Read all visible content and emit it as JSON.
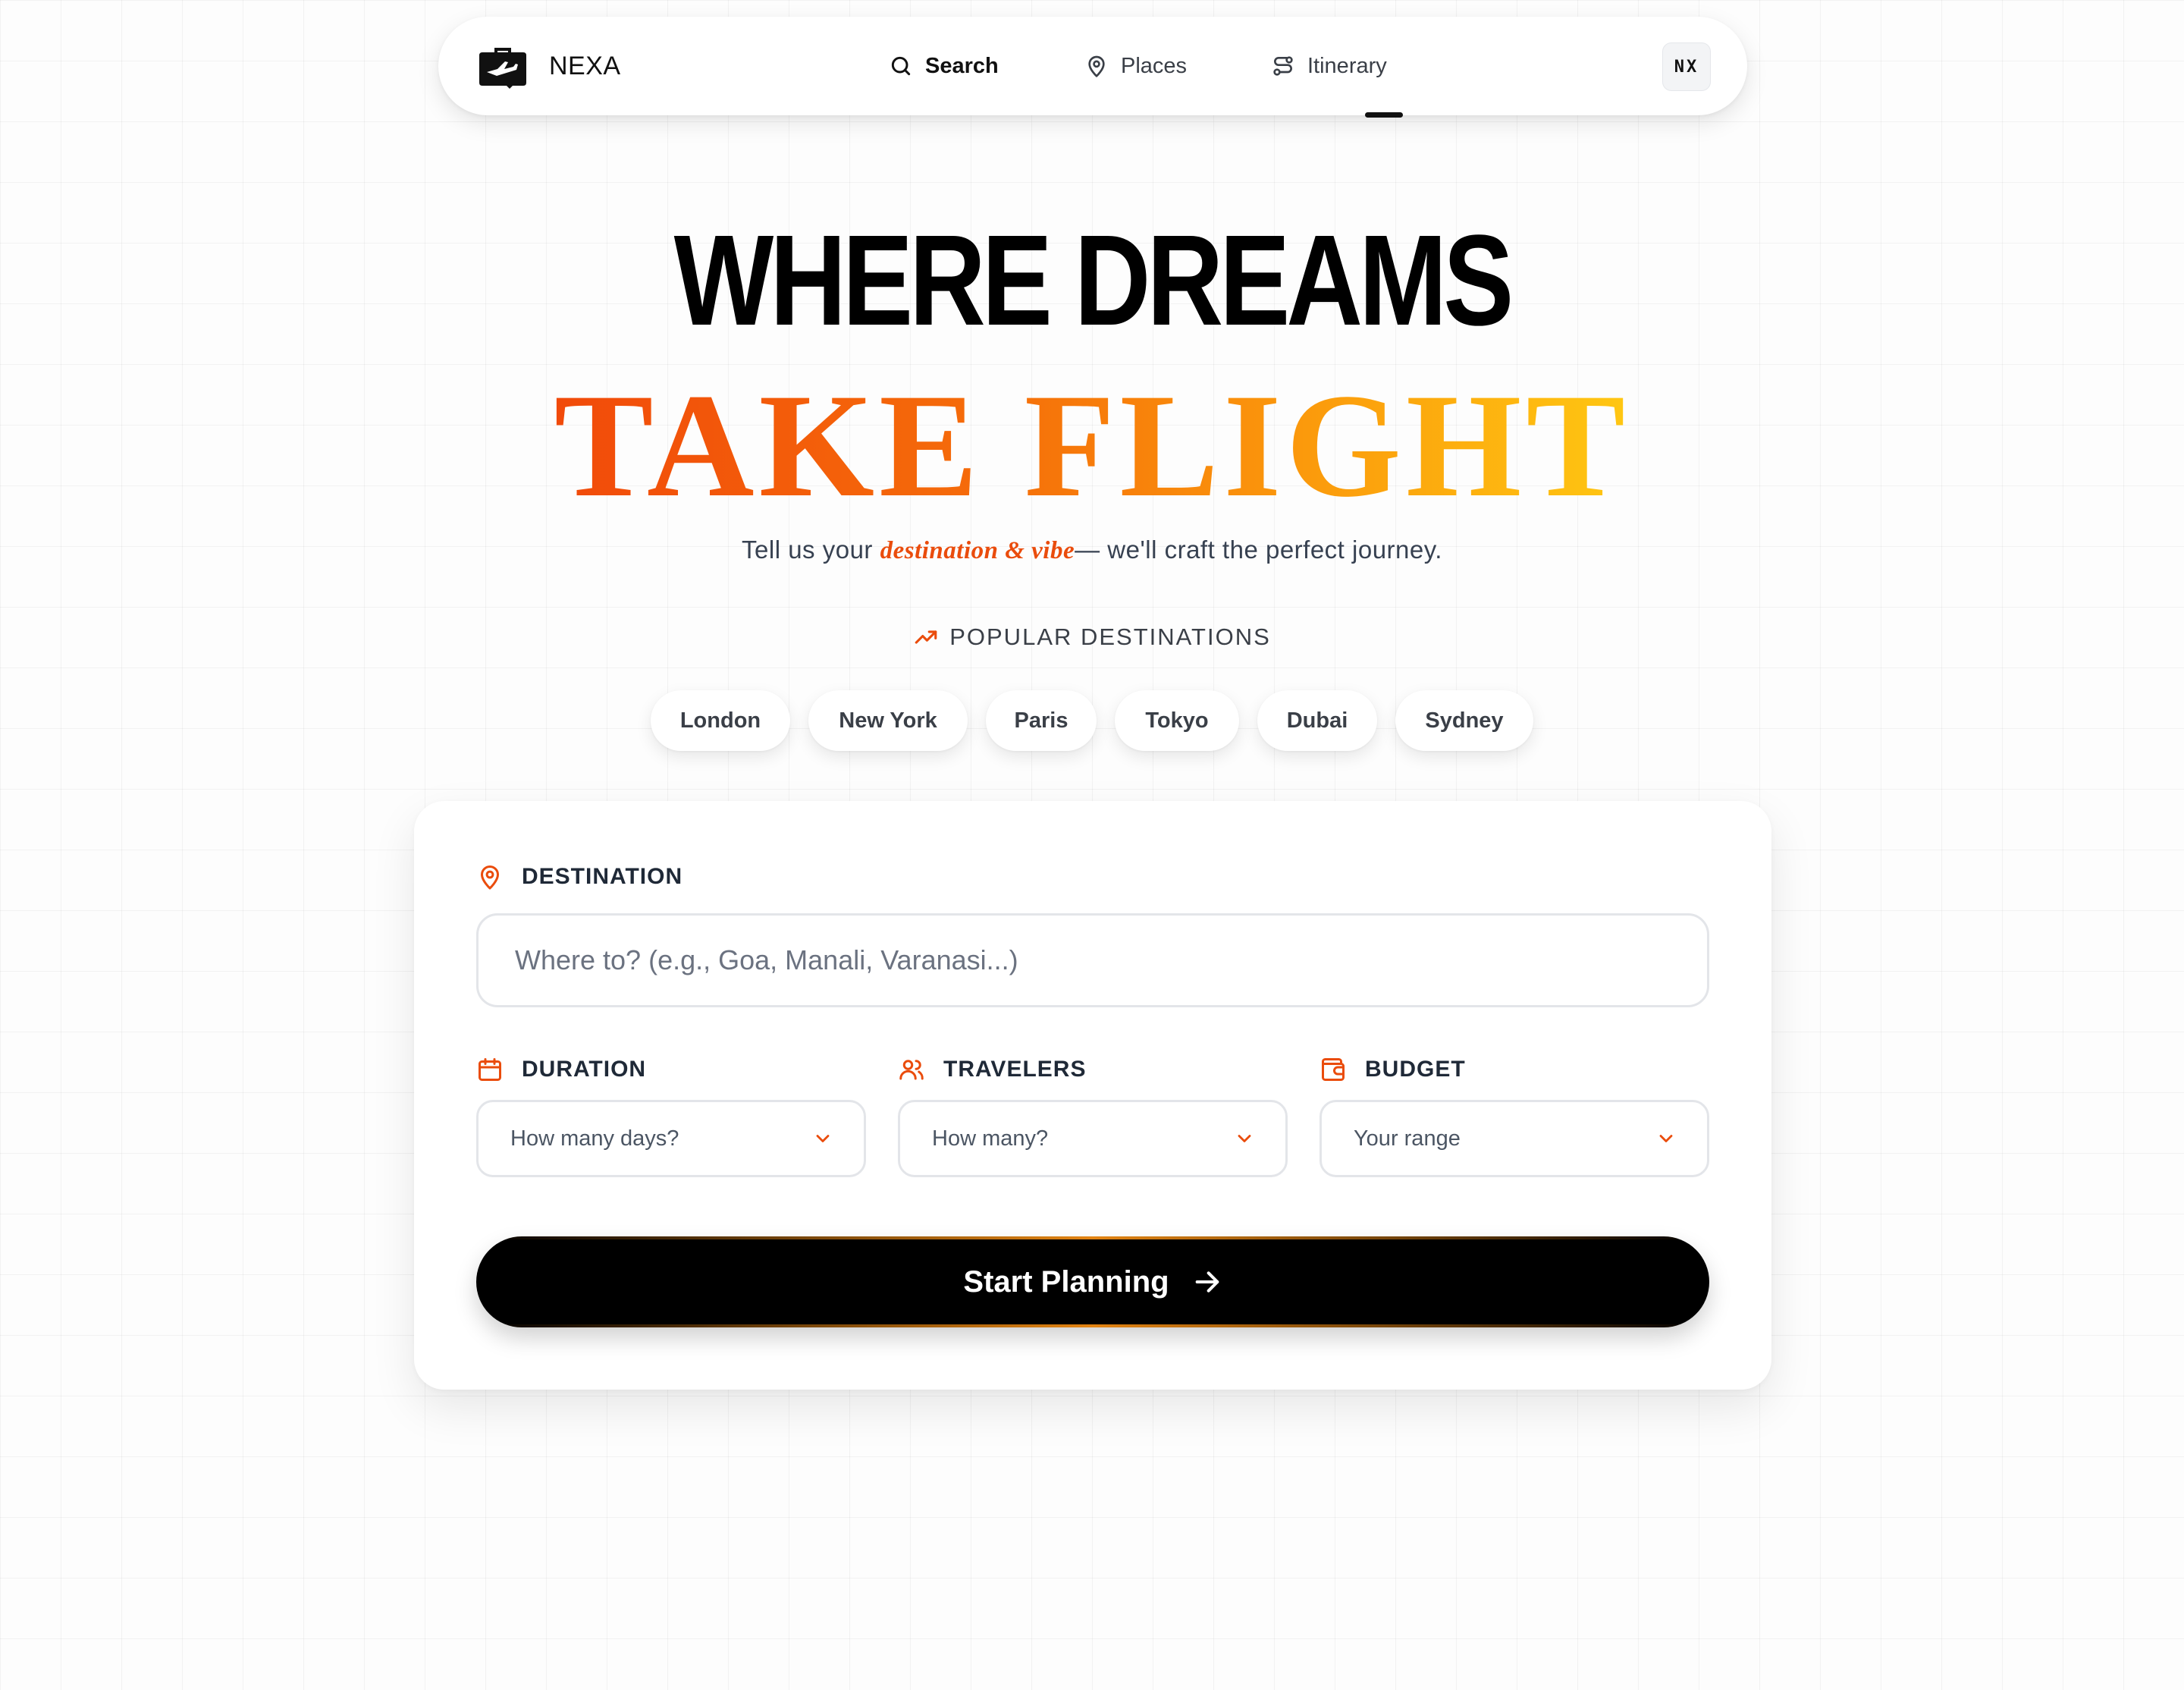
{
  "brand": {
    "name": "NEXA",
    "icon": "briefcase-plane-icon"
  },
  "nav": {
    "items": [
      {
        "label": "Search",
        "icon": "search-icon",
        "active": true
      },
      {
        "label": "Places",
        "icon": "map-pin-icon",
        "active": false
      },
      {
        "label": "Itinerary",
        "icon": "route-icon",
        "active": false
      }
    ],
    "avatar": "NX"
  },
  "hero": {
    "line1": "WHERE DREAMS",
    "line2": "TAKE FLIGHT",
    "tagline_before": "Tell us your ",
    "tagline_highlight": "destination & vibe",
    "tagline_after": "— we'll craft the perfect journey."
  },
  "popular": {
    "heading": "POPULAR DESTINATIONS",
    "icon": "trending-up-icon",
    "chips": [
      "London",
      "New York",
      "Paris",
      "Tokyo",
      "Dubai",
      "Sydney"
    ]
  },
  "form": {
    "destination_label": "DESTINATION",
    "destination_placeholder": "Where to? (e.g., Goa, Manali, Varanasi...)",
    "destination_value": "",
    "duration_label": "DURATION",
    "duration_value": "How many days?",
    "travelers_label": "TRAVELERS",
    "travelers_value": "How many?",
    "budget_label": "BUDGET",
    "budget_value": "Your range",
    "submit_label": "Start Planning"
  },
  "colors": {
    "accent": "#ea4c0c",
    "gradient_start": "#f14a0a",
    "gradient_end": "#ffc712",
    "button_bg": "#000000"
  }
}
